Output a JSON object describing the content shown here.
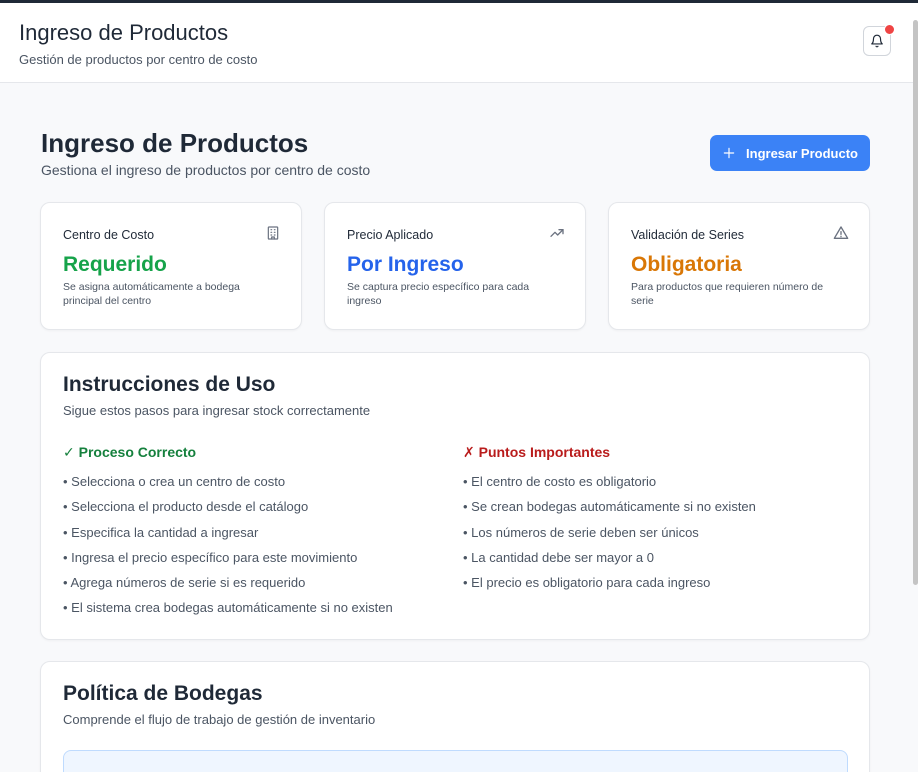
{
  "colors": {
    "accent": "#3b82f6",
    "success": "#16a34a",
    "info": "#2563eb",
    "warning": "#d97706",
    "danger": "#b91c1c",
    "notification": "#ef4444"
  },
  "header": {
    "title": "Ingreso de Productos",
    "subtitle": "Gestión de productos por centro de costo",
    "notification_icon": "bell-icon"
  },
  "page": {
    "title": "Ingreso de Productos",
    "subtitle": "Gestiona el ingreso de productos por centro de costo",
    "primary_button": {
      "icon": "plus-icon",
      "label": "Ingresar Producto"
    }
  },
  "stats": [
    {
      "label": "Centro de Costo",
      "icon": "building-icon",
      "value": "Requerido",
      "description": "Se asigna automáticamente a bodega principal del centro"
    },
    {
      "label": "Precio Aplicado",
      "icon": "trending-up-icon",
      "value": "Por Ingreso",
      "description": "Se captura precio específico para cada ingreso"
    },
    {
      "label": "Validación de Series",
      "icon": "alert-triangle-icon",
      "value": "Obligatoria",
      "description": "Para productos que requieren número de serie"
    }
  ],
  "instructions": {
    "title": "Instrucciones de Uso",
    "subtitle": "Sigue estos pasos para ingresar stock correctamente",
    "correct": {
      "heading": "✓ Proceso Correcto",
      "items": [
        "• Selecciona o crea un centro de costo",
        "• Selecciona el producto desde el catálogo",
        "• Especifica la cantidad a ingresar",
        "• Ingresa el precio específico para este movimiento",
        "• Agrega números de serie si es requerido",
        "• El sistema crea bodegas automáticamente si no existen"
      ]
    },
    "important": {
      "heading": "✗ Puntos Importantes",
      "items": [
        "• El centro de costo es obligatorio",
        "• Se crean bodegas automáticamente si no existen",
        "• Los números de serie deben ser únicos",
        "• La cantidad debe ser mayor a 0",
        "• El precio es obligatorio para cada ingreso"
      ]
    }
  },
  "policy": {
    "title": "Política de Bodegas",
    "subtitle": "Comprende el flujo de trabajo de gestión de inventario"
  }
}
